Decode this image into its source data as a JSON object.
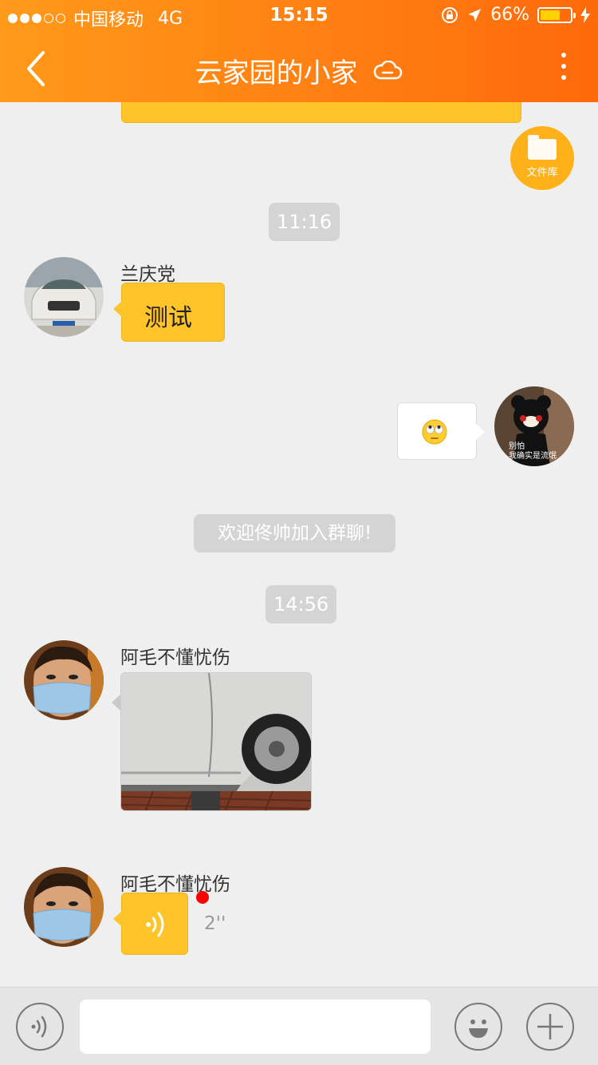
{
  "status_bar": {
    "carrier": "中国移动",
    "network": "4G",
    "time": "15:15",
    "battery": "66%",
    "battery_level": 0.66
  },
  "nav": {
    "title": "云家园的小家",
    "back_icon": "chevron-left-icon",
    "cloud_icon": "cloud-icon",
    "more_icon": "more-vertical-icon"
  },
  "file_library": {
    "label": "文件库",
    "icon": "folder-icon"
  },
  "messages": [
    {
      "type": "time",
      "text": "11:16"
    },
    {
      "type": "text",
      "sender": "兰庆党",
      "text": "测试"
    },
    {
      "type": "emoji",
      "sender": "me",
      "avatar_caption": [
        "别怕",
        "我确实是流氓"
      ]
    },
    {
      "type": "system",
      "text": "欢迎佟帅加入群聊!"
    },
    {
      "type": "time",
      "text": "14:56"
    },
    {
      "type": "image",
      "sender": "阿毛不懂忧伤"
    },
    {
      "type": "voice",
      "sender": "阿毛不懂忧伤",
      "duration": "2''"
    }
  ],
  "input_bar": {
    "placeholder": ""
  },
  "colors": {
    "header_start": "#ff9a1a",
    "header_end": "#ff6a0a",
    "bubble_yellow": "#ffc42a",
    "background": "#efefef"
  }
}
